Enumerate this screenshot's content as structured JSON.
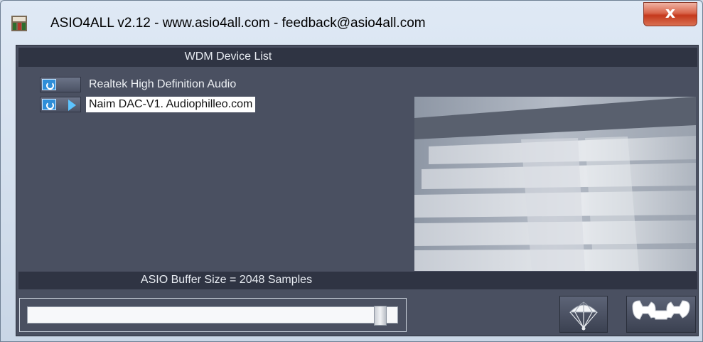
{
  "window": {
    "title": "ASIO4ALL v2.12 - www.asio4all.com - feedback@asio4all.com",
    "close_label": "x"
  },
  "device_list": {
    "header": "WDM Device List",
    "devices": [
      {
        "label": "Realtek High Definition Audio",
        "active": false,
        "selected": false
      },
      {
        "label": "Naim DAC-V1. Audiophilleo.com",
        "active": true,
        "selected": true
      }
    ]
  },
  "buffer": {
    "label": "ASIO Buffer Size = 2048 Samples",
    "slider_level": 0.97
  },
  "toolbar": {
    "parachute_icon": "parachute-icon",
    "settings_icon": "wrench-icon"
  },
  "colors": {
    "panel_bg": "#4a5061",
    "bar_bg": "#2f3443",
    "power_blue": "#2f8ed8",
    "arrow_blue": "#5cc4ff"
  }
}
